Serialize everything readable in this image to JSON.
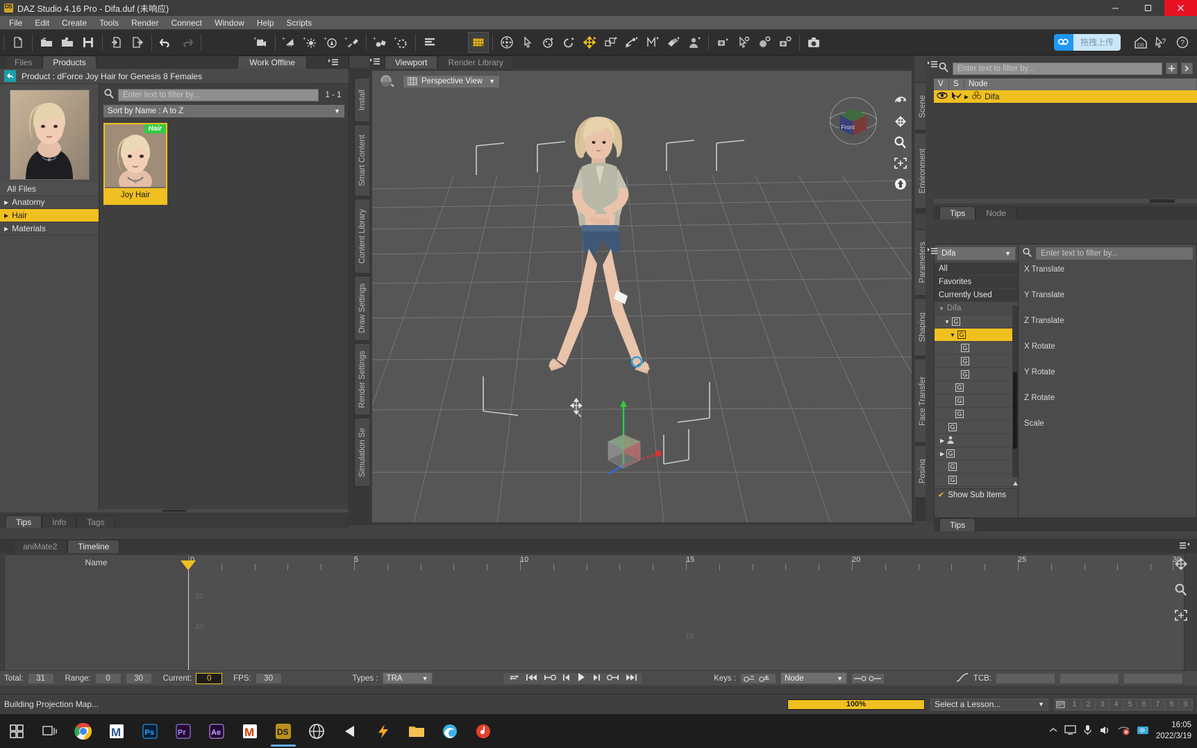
{
  "window": {
    "title": "DAZ Studio 4.16 Pro - Difa.duf (未响应)",
    "logo_label": "DS",
    "minimize": "–",
    "maximize": "□",
    "close": "✕"
  },
  "menubar": {
    "items": [
      "File",
      "Edit",
      "Create",
      "Tools",
      "Render",
      "Connect",
      "Window",
      "Help",
      "Scripts"
    ]
  },
  "toolbar": {
    "file_group": [
      "new-file-icon",
      "open-folder-icon",
      "open-recent-icon",
      "save-icon",
      "import-icon",
      "export-icon"
    ],
    "edit_group": [
      "undo-icon",
      "redo-icon"
    ],
    "create_group": [
      "add-camera-icon",
      "add-distant-light-icon",
      "add-point-light-icon",
      "add-spotlight-icon",
      "add-linear-light-icon",
      "add-primitive-icon",
      "add-null-icon",
      "layers-icon"
    ],
    "tool_group": [
      "surface-selection-icon",
      "universal-manipulator-icon",
      "node-selection-icon",
      "rotate-icon",
      "rotate-alt-icon",
      "translate-icon",
      "scale-icon",
      "joint-editor-icon",
      "mesh-grabber-icon",
      "surface-selection-alt-icon",
      "puppeteer-icon"
    ],
    "render_group": [
      "spot-render-icon",
      "aux-viewport-icon",
      "render-settings-icon",
      "render-icon",
      "camera-icon"
    ],
    "right_group": [
      "daz-home-icon",
      "help-cursor-icon",
      "help-circle-icon"
    ],
    "cloud_upload": {
      "icon": "cloud-upload-icon",
      "label": "拖拽上传"
    }
  },
  "left_pane": {
    "tabs": [
      {
        "label": "Files",
        "selected": false
      },
      {
        "label": "Products",
        "selected": true
      }
    ],
    "work_offline": "Work Offline",
    "panel_menu_icon": "panel-options-icon",
    "product_header": {
      "back_icon": "back-arrow-icon",
      "label": "Product :  dForce Joy Hair for Genesis 8 Females"
    },
    "categories": [
      {
        "label": "All Files",
        "expandable": false,
        "selected": false
      },
      {
        "label": "Anatomy",
        "expandable": true,
        "selected": false
      },
      {
        "label": "Hair",
        "expandable": true,
        "selected": true
      },
      {
        "label": "Materials",
        "expandable": true,
        "selected": false
      }
    ],
    "search": {
      "icon": "search-icon",
      "placeholder": "Enter text to filter by...",
      "value": "",
      "page_count": "1 - 1"
    },
    "sort": {
      "label": "Sort by Name : A to Z",
      "chevron": "chevron-down-icon"
    },
    "assets": [
      {
        "name": "Joy Hair",
        "badge": "Hair",
        "selected": true
      }
    ],
    "bottom_tabs": [
      {
        "label": "Tips",
        "selected": true
      },
      {
        "label": "Info",
        "selected": false
      },
      {
        "label": "Tags",
        "selected": false
      }
    ]
  },
  "left_vtabs": [
    "Install",
    "Smart Content",
    "Content Library",
    "Draw Settings",
    "Render Settings",
    "Simulation Se"
  ],
  "right_vtabs": [
    "Scene",
    "Environment"
  ],
  "param_vtabs": [
    "Parameters",
    "Shaping",
    "Face Transfer",
    "Posing"
  ],
  "viewport": {
    "tabs": [
      {
        "label": "Viewport",
        "selected": true
      },
      {
        "label": "Render Library",
        "selected": false
      }
    ],
    "panel_menu_icon": "panel-options-icon",
    "draw_style_icon": "draw-style-icon",
    "view_selector": {
      "icon": "camera-view-icon",
      "label": "Perspective View",
      "chevron": "chevron-down-icon"
    },
    "nav_cube_label": "Front",
    "side_tools": [
      "camera-cycle-icon",
      "orbit-icon",
      "pan-icon",
      "zoom-icon",
      "frame-icon",
      "reset-icon"
    ],
    "gizmo": {
      "x_axis": "#e03030",
      "y_axis": "#2ecc40",
      "z_axis": "#2a6fdb"
    },
    "selection_ring_color": "#29a3e0"
  },
  "scene_pane": {
    "search": {
      "icon": "search-icon",
      "placeholder": "Enter text to filter by...",
      "value": ""
    },
    "add_icon": "add-node-icon",
    "menu_icon": "scene-menu-icon",
    "columns": [
      "V",
      "S",
      "Node"
    ],
    "rows": [
      {
        "name": "Difa",
        "visible_icon": "eye-icon",
        "select_icon": "cursor-check-icon",
        "expand_icon": "chevron-right-icon",
        "type_icon": "figure-icon",
        "selected": true
      }
    ],
    "tabs": [
      {
        "label": "Tips",
        "selected": true
      },
      {
        "label": "Node",
        "selected": false
      }
    ]
  },
  "parameters_pane": {
    "combo": {
      "value": "Difa",
      "chevron": "chevron-down-icon"
    },
    "search": {
      "icon": "search-icon",
      "placeholder": "Enter text to filter by...",
      "value": ""
    },
    "groups": [
      {
        "label": "All",
        "kind": "header",
        "selected": false
      },
      {
        "label": "Favorites",
        "kind": "header",
        "selected": false
      },
      {
        "label": "Currently Used",
        "kind": "header",
        "selected": false
      },
      {
        "label": "Difa",
        "kind": "root",
        "indent": 0,
        "expanded": true,
        "selected": false
      },
      {
        "label": "G",
        "kind": "node",
        "indent": 1,
        "expanded": true,
        "selected": false
      },
      {
        "label": "G",
        "kind": "node",
        "indent": 2,
        "expanded": true,
        "selected": true
      },
      {
        "label": "G",
        "kind": "node",
        "indent": 3,
        "expanded": false,
        "selected": false
      },
      {
        "label": "G",
        "kind": "node",
        "indent": 3,
        "expanded": false,
        "selected": false
      },
      {
        "label": "G",
        "kind": "node",
        "indent": 3,
        "expanded": false,
        "selected": false
      },
      {
        "label": "G",
        "kind": "node",
        "indent": 2,
        "expanded": false,
        "selected": false
      },
      {
        "label": "G",
        "kind": "node",
        "indent": 2,
        "expanded": false,
        "selected": false
      },
      {
        "label": "G",
        "kind": "node",
        "indent": 2,
        "expanded": false,
        "selected": false
      },
      {
        "label": "G",
        "kind": "node",
        "indent": 1,
        "expanded": false,
        "selected": false
      },
      {
        "label": "",
        "kind": "person",
        "indent": 1,
        "expanded": false,
        "selected": false
      },
      {
        "label": "G",
        "kind": "node",
        "indent": 1,
        "expanded": false,
        "selected": false
      },
      {
        "label": "G",
        "kind": "node",
        "indent": 1,
        "expanded": false,
        "selected": false
      },
      {
        "label": "G",
        "kind": "node",
        "indent": 1,
        "expanded": false,
        "selected": false
      }
    ],
    "show_sub_items": {
      "label": "Show Sub Items",
      "checked": true,
      "check_glyph": "✔"
    },
    "properties": [
      "X Translate",
      "Y Translate",
      "Z Translate",
      "X Rotate",
      "Y Rotate",
      "Z Rotate",
      "Scale"
    ],
    "bottom_tabs": [
      {
        "label": "Tips",
        "selected": true
      }
    ]
  },
  "timeline": {
    "tabs": [
      {
        "label": "aniMate2",
        "selected": false
      },
      {
        "label": "Timeline",
        "selected": true
      }
    ],
    "name_column": "Name",
    "ruler": {
      "labels": [
        "0",
        "5",
        "10",
        "15",
        "20",
        "25",
        "30"
      ],
      "frame_min": 0,
      "frame_max": 30
    },
    "inner_labels": [
      "10",
      "10",
      "15"
    ],
    "scroll_left_label": "0",
    "scroll_right_label": "30",
    "right_tools": [
      "move-keys-icon",
      "zoom-keys-icon",
      "frame-all-icon"
    ],
    "controls": {
      "total_label": "Total:",
      "total_value": "31",
      "range_label": "Range:",
      "range_start": "0",
      "range_end": "30",
      "current_label": "Current:",
      "current_value": "0",
      "fps_label": "FPS:",
      "fps_value": "30",
      "types_label": "Types :",
      "types_value": "TRA",
      "playback_icons": [
        "loop-icon",
        "first-frame-icon",
        "prev-key-icon",
        "prev-frame-icon",
        "play-icon",
        "next-frame-icon",
        "next-key-icon",
        "last-frame-icon"
      ],
      "keys_label": "Keys :",
      "keys_icons": [
        "delete-key-icon",
        "add-key-icon"
      ],
      "node_value": "Node",
      "key_nav_icons": [
        "prev-keyed-icon",
        "next-keyed-icon"
      ],
      "interp_icon": "interpolation-icon",
      "tcb_label": "TCB:",
      "tcb_fields": [
        "",
        "",
        ""
      ]
    }
  },
  "statusbar": {
    "message": "Building Projection Map...",
    "progress_label": "100%",
    "progress_percent": 100,
    "lesson_combo": {
      "value": "Select a Lesson...",
      "chevron": "chevron-down-icon"
    },
    "lesson_icon": "lesson-icon",
    "lesson_numbers": [
      "1",
      "2",
      "3",
      "4",
      "5",
      "6",
      "7",
      "8",
      "9"
    ],
    "accent_color": "#f0c020"
  },
  "taskbar": {
    "items": [
      {
        "name": "windows-start-icon",
        "glyph": "⊞",
        "color": "#ffffff",
        "active": false
      },
      {
        "name": "task-view-icon",
        "glyph": "❐",
        "color": "#e8e8e8",
        "active": false
      },
      {
        "name": "chrome-icon",
        "glyph": "◉",
        "color": "#4285f4",
        "active": false
      },
      {
        "name": "word-icon",
        "glyph": "M",
        "color": "#2b579a",
        "active": false
      },
      {
        "name": "photoshop-icon",
        "glyph": "Ps",
        "color": "#31a8ff",
        "active": false
      },
      {
        "name": "premiere-icon",
        "glyph": "Pr",
        "color": "#9999ff",
        "active": false
      },
      {
        "name": "after-effects-icon",
        "glyph": "Ae",
        "color": "#d6a0ff",
        "active": false
      },
      {
        "name": "outlook-icon",
        "glyph": "M",
        "color": "#d83b01",
        "active": false
      },
      {
        "name": "daz-studio-icon",
        "glyph": "DS",
        "color": "#f0c020",
        "active": true
      },
      {
        "name": "browser-icon",
        "glyph": "◍",
        "color": "#e8e8e8",
        "active": false
      },
      {
        "name": "media-player-icon",
        "glyph": "◀",
        "color": "#e8e8e8",
        "active": false
      },
      {
        "name": "thunder-download-icon",
        "glyph": "⚡",
        "color": "#f5a623",
        "active": false
      },
      {
        "name": "file-explorer-icon",
        "glyph": "🗀",
        "color": "#f5c251",
        "active": false
      },
      {
        "name": "edge-icon",
        "glyph": "◐",
        "color": "#3bb0e8",
        "active": false
      },
      {
        "name": "netease-music-icon",
        "glyph": "♪",
        "color": "#e8402a",
        "active": false
      }
    ],
    "tray": {
      "chevron": "tray-expand-icon",
      "icons": [
        "screen-icon",
        "mic-icon",
        "volume-icon",
        "network-error-icon",
        "input-method-icon"
      ],
      "time": "16:05",
      "date": "2022/3/19"
    }
  }
}
